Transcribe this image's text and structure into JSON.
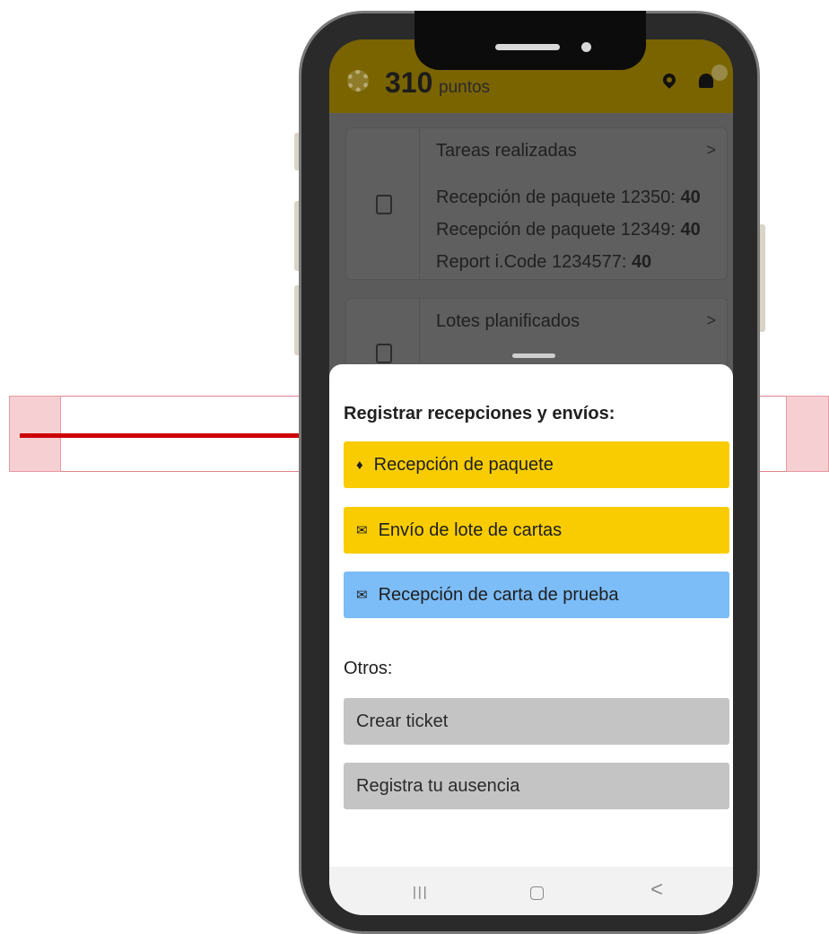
{
  "header": {
    "points_value": "310",
    "points_label": "puntos",
    "icons": [
      "gear-icon",
      "location-pin-icon",
      "bell-icon"
    ]
  },
  "cards": {
    "tasks": {
      "title": "Tareas realizadas",
      "chevron": ">",
      "lines": [
        {
          "text": "Recepción de paquete 12350: ",
          "value": "40"
        },
        {
          "text": "Recepción de paquete 12349: ",
          "value": "40"
        },
        {
          "text": "Report i.Code 1234577: ",
          "value": "40"
        }
      ]
    },
    "lots": {
      "title": "Lotes planificados",
      "chevron": ">"
    }
  },
  "sheet": {
    "section1_title": "Registrar recepciones y envíos:",
    "buttons": [
      {
        "label": "Recepción de paquete",
        "icon": "package-icon",
        "color": "#f8cc00"
      },
      {
        "label": "Envío de lote de cartas",
        "icon": "envelope-icon",
        "color": "#f8cc00"
      },
      {
        "label": "Recepción de carta de prueba",
        "icon": "mailbox-icon",
        "color": "#7cbcf7"
      }
    ],
    "section2_title": "Otros:",
    "others": [
      {
        "label": "Crear ticket"
      },
      {
        "label": "Registra tu ausencia"
      }
    ]
  },
  "navbar": {
    "recent": "|||",
    "back": "<"
  },
  "colors": {
    "header_bg": "#7a6400",
    "primary_button": "#f8cc00",
    "secondary_button": "#7cbcf7",
    "other_button": "#c4c4c4",
    "highlight_arrow": "#cc0000"
  }
}
